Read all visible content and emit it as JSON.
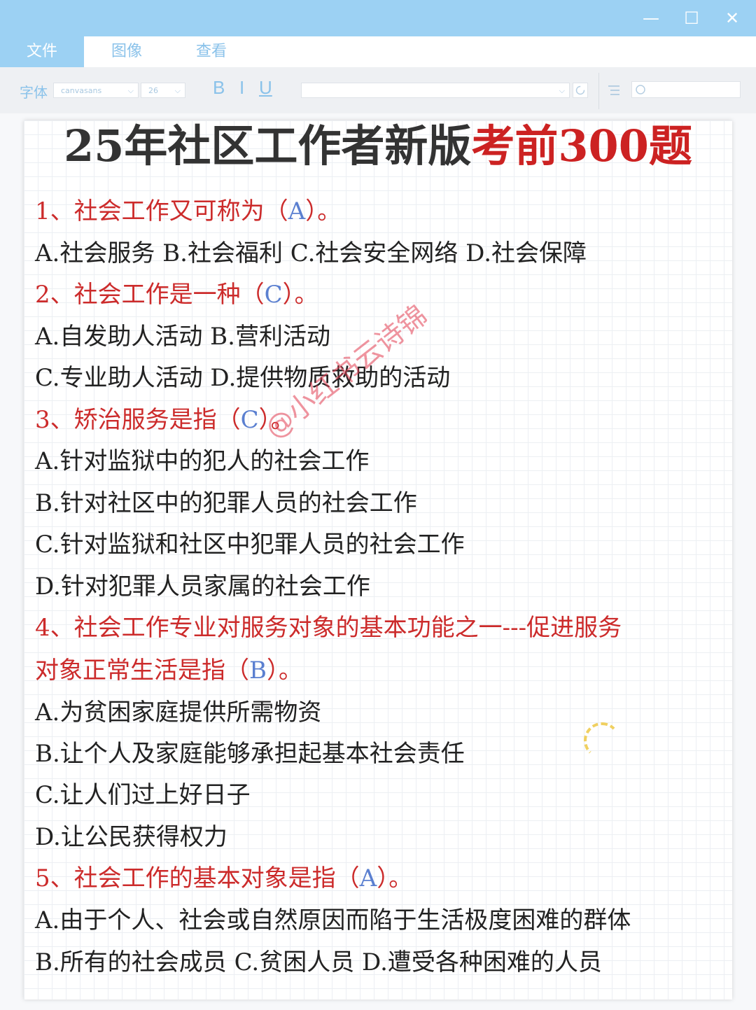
{
  "window": {
    "minimize_glyph": "—",
    "maximize_glyph": "☐",
    "close_glyph": "✕"
  },
  "menu": {
    "tabs": [
      "文件",
      "图像",
      "查看"
    ]
  },
  "toolbar": {
    "font_label": "字体",
    "font_name": "canvasans",
    "font_size": "26",
    "bold": "B",
    "italic": "I",
    "underline": "U",
    "chevron": "⌵"
  },
  "document": {
    "title_main": "25年社区工作者新版",
    "title_highlight": "考前300题",
    "watermark": "@小红书云诗锦",
    "lines": [
      {
        "kind": "question",
        "pre": "1、社会工作又可称为（",
        "answer": "A",
        "post": "）。"
      },
      {
        "kind": "option",
        "text": "A.社会服务  B.社会福利  C.社会安全网络  D.社会保障"
      },
      {
        "kind": "question",
        "pre": "2、社会工作是一种（",
        "answer": "C",
        "post": "）。"
      },
      {
        "kind": "option",
        "text": "A.自发助人活动  B.营利活动"
      },
      {
        "kind": "option",
        "text": "C.专业助人活动  D.提供物质救助的活动"
      },
      {
        "kind": "question",
        "pre": "3、矫治服务是指（",
        "answer": "C",
        "post": "）。"
      },
      {
        "kind": "option",
        "text": "A.针对监狱中的犯人的社会工作"
      },
      {
        "kind": "option",
        "text": "B.针对社区中的犯罪人员的社会工作"
      },
      {
        "kind": "option",
        "text": "C.针对监狱和社区中犯罪人员的社会工作"
      },
      {
        "kind": "option",
        "text": "D.针对犯罪人员家属的社会工作"
      },
      {
        "kind": "question",
        "pre": "4、社会工作专业对服务对象的基本功能之一---促进服务",
        "answer": "",
        "post": ""
      },
      {
        "kind": "question",
        "pre": "对象正常生活是指（",
        "answer": "B",
        "post": "）。"
      },
      {
        "kind": "option",
        "text": "A.为贫困家庭提供所需物资"
      },
      {
        "kind": "option",
        "text": "B.让个人及家庭能够承担起基本社会责任"
      },
      {
        "kind": "option",
        "text": "C.让人们过上好日子"
      },
      {
        "kind": "option",
        "text": "D.让公民获得权力"
      },
      {
        "kind": "question",
        "pre": "5、社会工作的基本对象是指（",
        "answer": "A",
        "post": "）。"
      },
      {
        "kind": "option",
        "text": "A.由于个人、社会或自然原因而陷于生活极度困难的群体"
      },
      {
        "kind": "option",
        "text": "B.所有的社会成员   C.贫困人员  D.遭受各种困难的人员"
      }
    ]
  }
}
